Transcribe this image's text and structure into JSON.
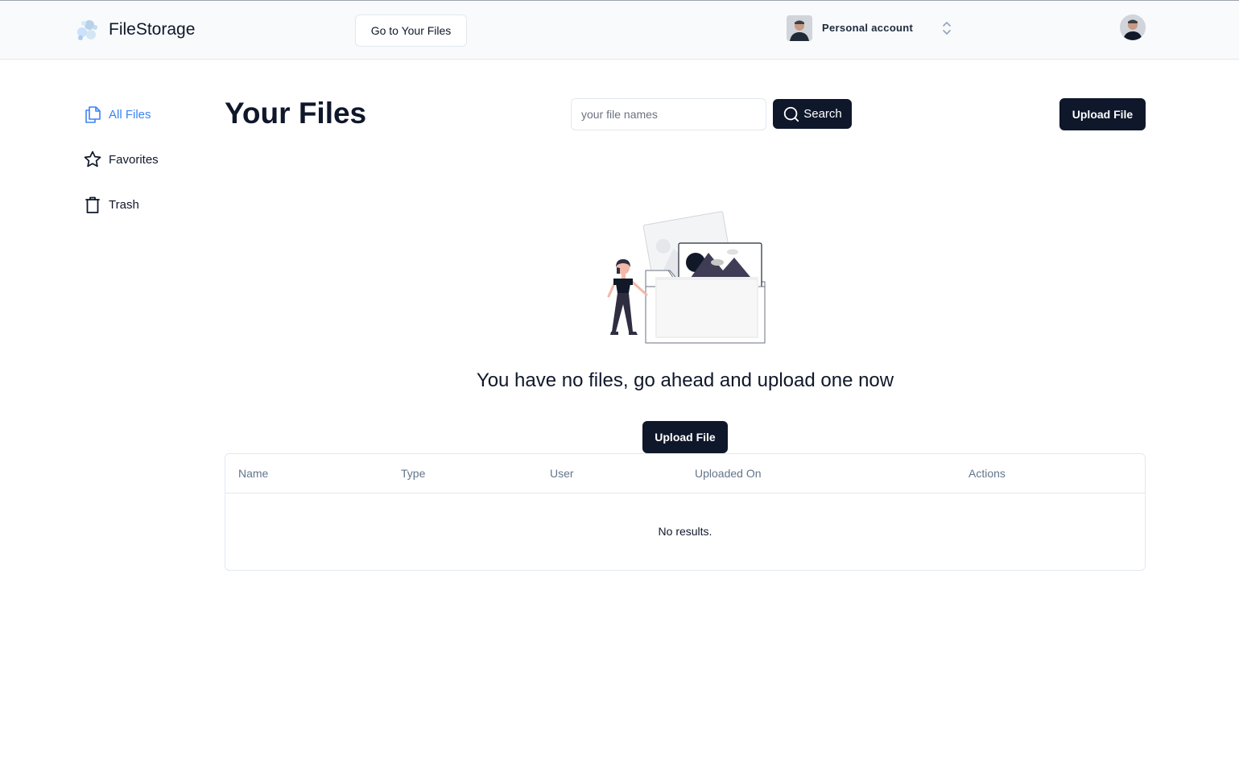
{
  "header": {
    "brand": "FileStorage",
    "goto_label": "Go to Your Files",
    "account_label": "Personal account"
  },
  "sidebar": {
    "items": [
      {
        "label": "All Files",
        "icon": "file-icon",
        "active": true
      },
      {
        "label": "Favorites",
        "icon": "star-icon",
        "active": false
      },
      {
        "label": "Trash",
        "icon": "trash-icon",
        "active": false
      }
    ]
  },
  "main": {
    "title": "Your Files",
    "search_placeholder": "your file names",
    "search_value": "",
    "search_label": "Search",
    "upload_label": "Upload File",
    "empty_message": "You have no files, go ahead and upload one now",
    "empty_upload_label": "Upload File"
  },
  "table": {
    "columns": [
      "Name",
      "Type",
      "User",
      "Uploaded On",
      "Actions"
    ],
    "rows": [],
    "empty_text": "No results."
  },
  "colors": {
    "primary": "#0f172a",
    "accent": "#3b82f6",
    "header_bg": "#f8fafc",
    "border": "#e2e8f0"
  }
}
